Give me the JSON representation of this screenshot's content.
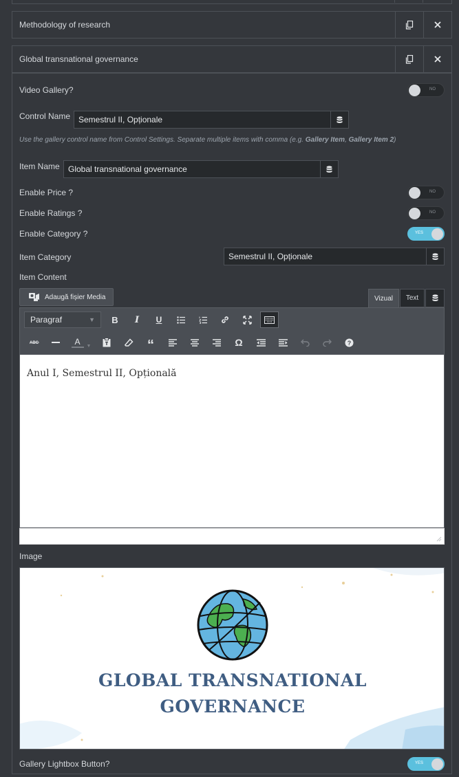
{
  "repeater_items": [
    {
      "title": "Methodology of research",
      "duplicate_icon": "copy-icon",
      "remove_icon": "close-icon"
    },
    {
      "title": "Global transnational governance",
      "duplicate_icon": "copy-icon",
      "remove_icon": "close-icon"
    }
  ],
  "fields": {
    "video_gallery": {
      "label": "Video Gallery?",
      "toggle": "NO"
    },
    "control_name": {
      "label": "Control Name",
      "value": "Semestrul II, Opționale"
    },
    "description": {
      "prefix": "Use the gallery control name from Control Settings. Separate multiple items with comma (e.g. ",
      "example1": "Gallery Item",
      "sep": ", ",
      "example2": "Gallery Item 2",
      "suffix": ")"
    },
    "item_name": {
      "label": "Item Name",
      "value": "Global transnational governance"
    },
    "enable_price": {
      "label": "Enable Price ?",
      "toggle": "NO"
    },
    "enable_ratings": {
      "label": "Enable Ratings ?",
      "toggle": "NO"
    },
    "enable_category": {
      "label": "Enable Category ?",
      "toggle": "YES"
    },
    "item_category": {
      "label": "Item Category",
      "value": "Semestrul II, Opționale"
    },
    "item_content": {
      "label": "Item Content"
    },
    "image": {
      "label": "Image"
    },
    "gallery_lightbox": {
      "label": "Gallery Lightbox Button?",
      "toggle": "YES"
    }
  },
  "editor": {
    "add_media_label": "Adaugă fișier Media",
    "tabs": {
      "visual": "Vizual",
      "text": "Text"
    },
    "format_select": "Paragraf",
    "content": "Anul I, Semestrul II, Opțională"
  },
  "image_preview": {
    "title_line1": "GLOBAL TRANSNATIONAL",
    "title_line2": "GOVERNANCE"
  },
  "colors": {
    "background": "#34373c",
    "input_bg": "#26292c",
    "toggle_on": "#5bc0de",
    "image_title": "#3f5d82"
  }
}
